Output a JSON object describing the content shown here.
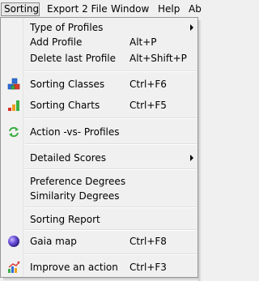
{
  "menubar": {
    "items": [
      {
        "label": "Sorting"
      },
      {
        "label": "Export 2 File"
      },
      {
        "label": "Window"
      },
      {
        "label": "Help"
      },
      {
        "label": "Ab"
      }
    ]
  },
  "menu": {
    "items": [
      {
        "label": "Type of Profiles",
        "shortcut": "",
        "submenu": true,
        "icon": ""
      },
      {
        "label": "Add Profile",
        "shortcut": "Alt+P",
        "icon": ""
      },
      {
        "label": "Delete last Profile",
        "shortcut": "Alt+Shift+P",
        "icon": ""
      },
      {
        "label": "Sorting Classes",
        "shortcut": "Ctrl+F6",
        "icon": "sorting-classes-icon"
      },
      {
        "label": "Sorting Charts",
        "shortcut": "Ctrl+F5",
        "icon": "bar-chart-icon"
      },
      {
        "label": "Action -vs- Profiles",
        "shortcut": "",
        "icon": "refresh-arrows-icon"
      },
      {
        "label": "Detailed Scores",
        "shortcut": "",
        "submenu": true,
        "icon": ""
      },
      {
        "label": "Preference Degrees",
        "shortcut": "",
        "icon": ""
      },
      {
        "label": "Similarity Degrees",
        "shortcut": "",
        "icon": ""
      },
      {
        "label": "Sorting Report",
        "shortcut": "",
        "icon": ""
      },
      {
        "label": "Gaia map",
        "shortcut": "Ctrl+F8",
        "icon": "globe-icon"
      },
      {
        "label": "Improve an action",
        "shortcut": "Ctrl+F3",
        "icon": "improve-chart-icon"
      }
    ]
  }
}
